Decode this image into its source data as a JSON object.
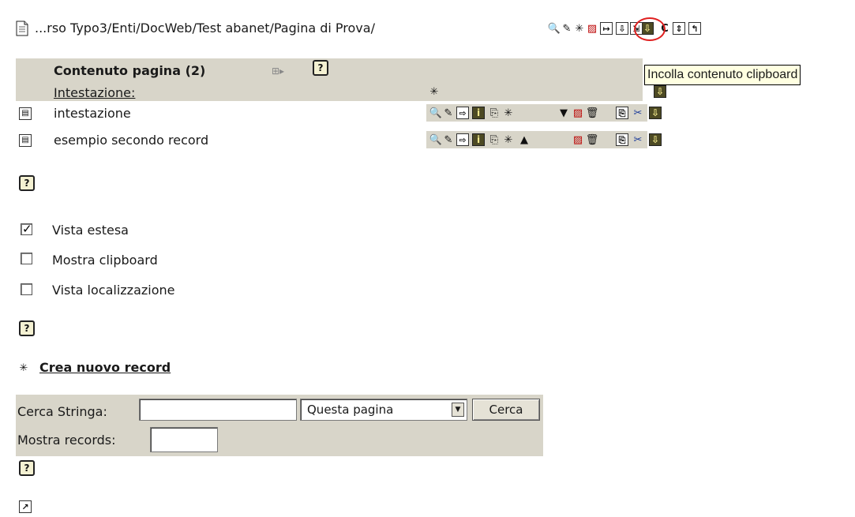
{
  "path_bar": {
    "path": "...rso Typo3/Enti/DocWeb/Test abanet/Pagina di Prova/",
    "page_icon": "page-icon",
    "actions": [
      "zoom-icon",
      "edit-icon",
      "new-record-icon",
      "edit-page-icon",
      "move-page-icon",
      "paste-clipboard-icon",
      "history-icon",
      "sort-icon",
      "up-level-icon"
    ]
  },
  "tooltip": {
    "text": "Incolla contenuto clipboard"
  },
  "table": {
    "header_title": "Contenuto pagina (2)",
    "column_header": "Intestazione:",
    "rows": [
      {
        "label": "intestazione",
        "icon": "content-element-icon"
      },
      {
        "label": "esempio secondo record",
        "icon": "content-element-icon"
      }
    ]
  },
  "options": {
    "items": [
      {
        "label": "Vista estesa",
        "checked": true
      },
      {
        "label": "Mostra clipboard",
        "checked": false
      },
      {
        "label": "Vista localizzazione",
        "checked": false
      }
    ]
  },
  "create_new": {
    "label": "Crea nuovo record"
  },
  "search": {
    "label": "Cerca Stringa:",
    "value": "",
    "scope_selected": "Questa pagina",
    "button_label": "Cerca",
    "records_label": "Mostra records:",
    "records_value": ""
  },
  "colors": {
    "band": "#d8d5c9",
    "tooltip_bg": "#ffffe1",
    "highlight_circle": "#e02020"
  }
}
